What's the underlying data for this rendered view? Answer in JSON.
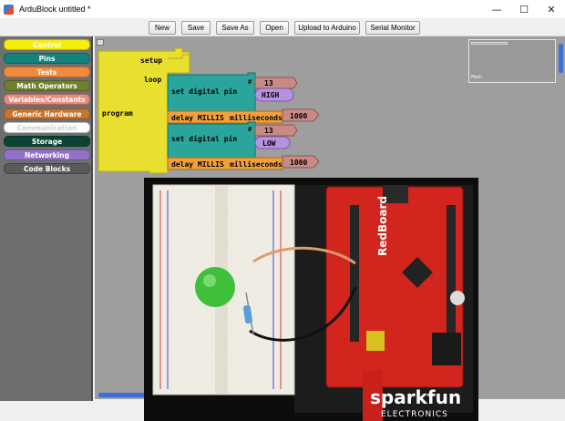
{
  "window": {
    "title": "ArduBlock untitled *",
    "minimize_glyph": "—",
    "maximize_glyph": "☐",
    "close_glyph": "✕"
  },
  "toolbar": {
    "buttons": [
      "New",
      "Save",
      "Save As",
      "Open",
      "Upload to Arduino",
      "Serial Monitor"
    ]
  },
  "palette": {
    "categories": [
      {
        "label": "Control",
        "color": "#f5ee0c",
        "text_color": "#ffffff"
      },
      {
        "label": "Pins",
        "color": "#12837a",
        "text_color": "#ffffff"
      },
      {
        "label": "Tests",
        "color": "#f08a3c",
        "text_color": "#ffffff"
      },
      {
        "label": "Math Operators",
        "color": "#6e7f2e",
        "text_color": "#ffffff"
      },
      {
        "label": "Variables/Constants",
        "color": "#e98a7e",
        "text_color": "#ffffff"
      },
      {
        "label": "Generic Hardware",
        "color": "#c8742c",
        "text_color": "#ffffff"
      },
      {
        "label": "Communication",
        "color": "#ffffff",
        "text_color": "#cfcfcf"
      },
      {
        "label": "Storage",
        "color": "#0b4436",
        "text_color": "#ffffff"
      },
      {
        "label": "Networking",
        "color": "#9371c9",
        "text_color": "#ffffff"
      },
      {
        "label": "Code Blocks",
        "color": "#5a5a5a",
        "text_color": "#ffffff"
      }
    ]
  },
  "program": {
    "block_label": "program",
    "setup_label": "setup",
    "loop_label": "loop",
    "statements": [
      {
        "kind": "set digital pin",
        "pin_label": "#",
        "pin": "13",
        "value": "HIGH"
      },
      {
        "kind": "delay MILLIS",
        "unit": "milliseconds",
        "value": "1000"
      },
      {
        "kind": "set digital pin",
        "pin_label": "#",
        "pin": "13",
        "value": "LOW"
      },
      {
        "kind": "delay MILLIS",
        "unit": "milliseconds",
        "value": "1000"
      }
    ]
  },
  "minimap": {
    "label": "Main"
  },
  "photo": {
    "board_text": "RedBoard",
    "brand_text": "sparkfun",
    "brand_subtext": "ELECTRONICS"
  },
  "colors": {
    "control": "#e6dc3c",
    "pins": "#2aa59c",
    "value": "#b792e0",
    "number": "#c98a84",
    "workspace": "#9e9e9e",
    "scroll": "#3d6fd8"
  }
}
